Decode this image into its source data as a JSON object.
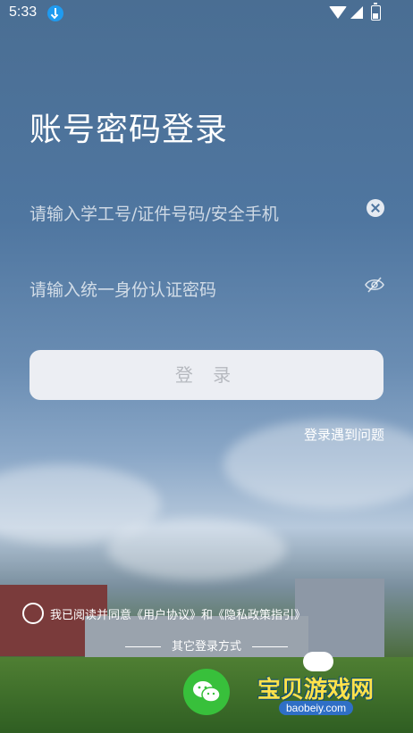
{
  "status_bar": {
    "time": "5:33"
  },
  "login": {
    "title": "账号密码登录",
    "username_placeholder": "请输入学工号/证件号码/安全手机",
    "password_placeholder": "请输入统一身份认证密码",
    "login_button": "登 录",
    "help_link": "登录遇到问题"
  },
  "agreement": {
    "text": "我已阅读并同意《用户协议》和《隐私政策指引》"
  },
  "other_login": {
    "label": "其它登录方式"
  },
  "watermark": {
    "title": "宝贝游戏网",
    "url": "baobeiy.com"
  },
  "colors": {
    "wechat": "#38c03b",
    "button_bg": "#eceef3",
    "download": "#1f9bf0"
  }
}
